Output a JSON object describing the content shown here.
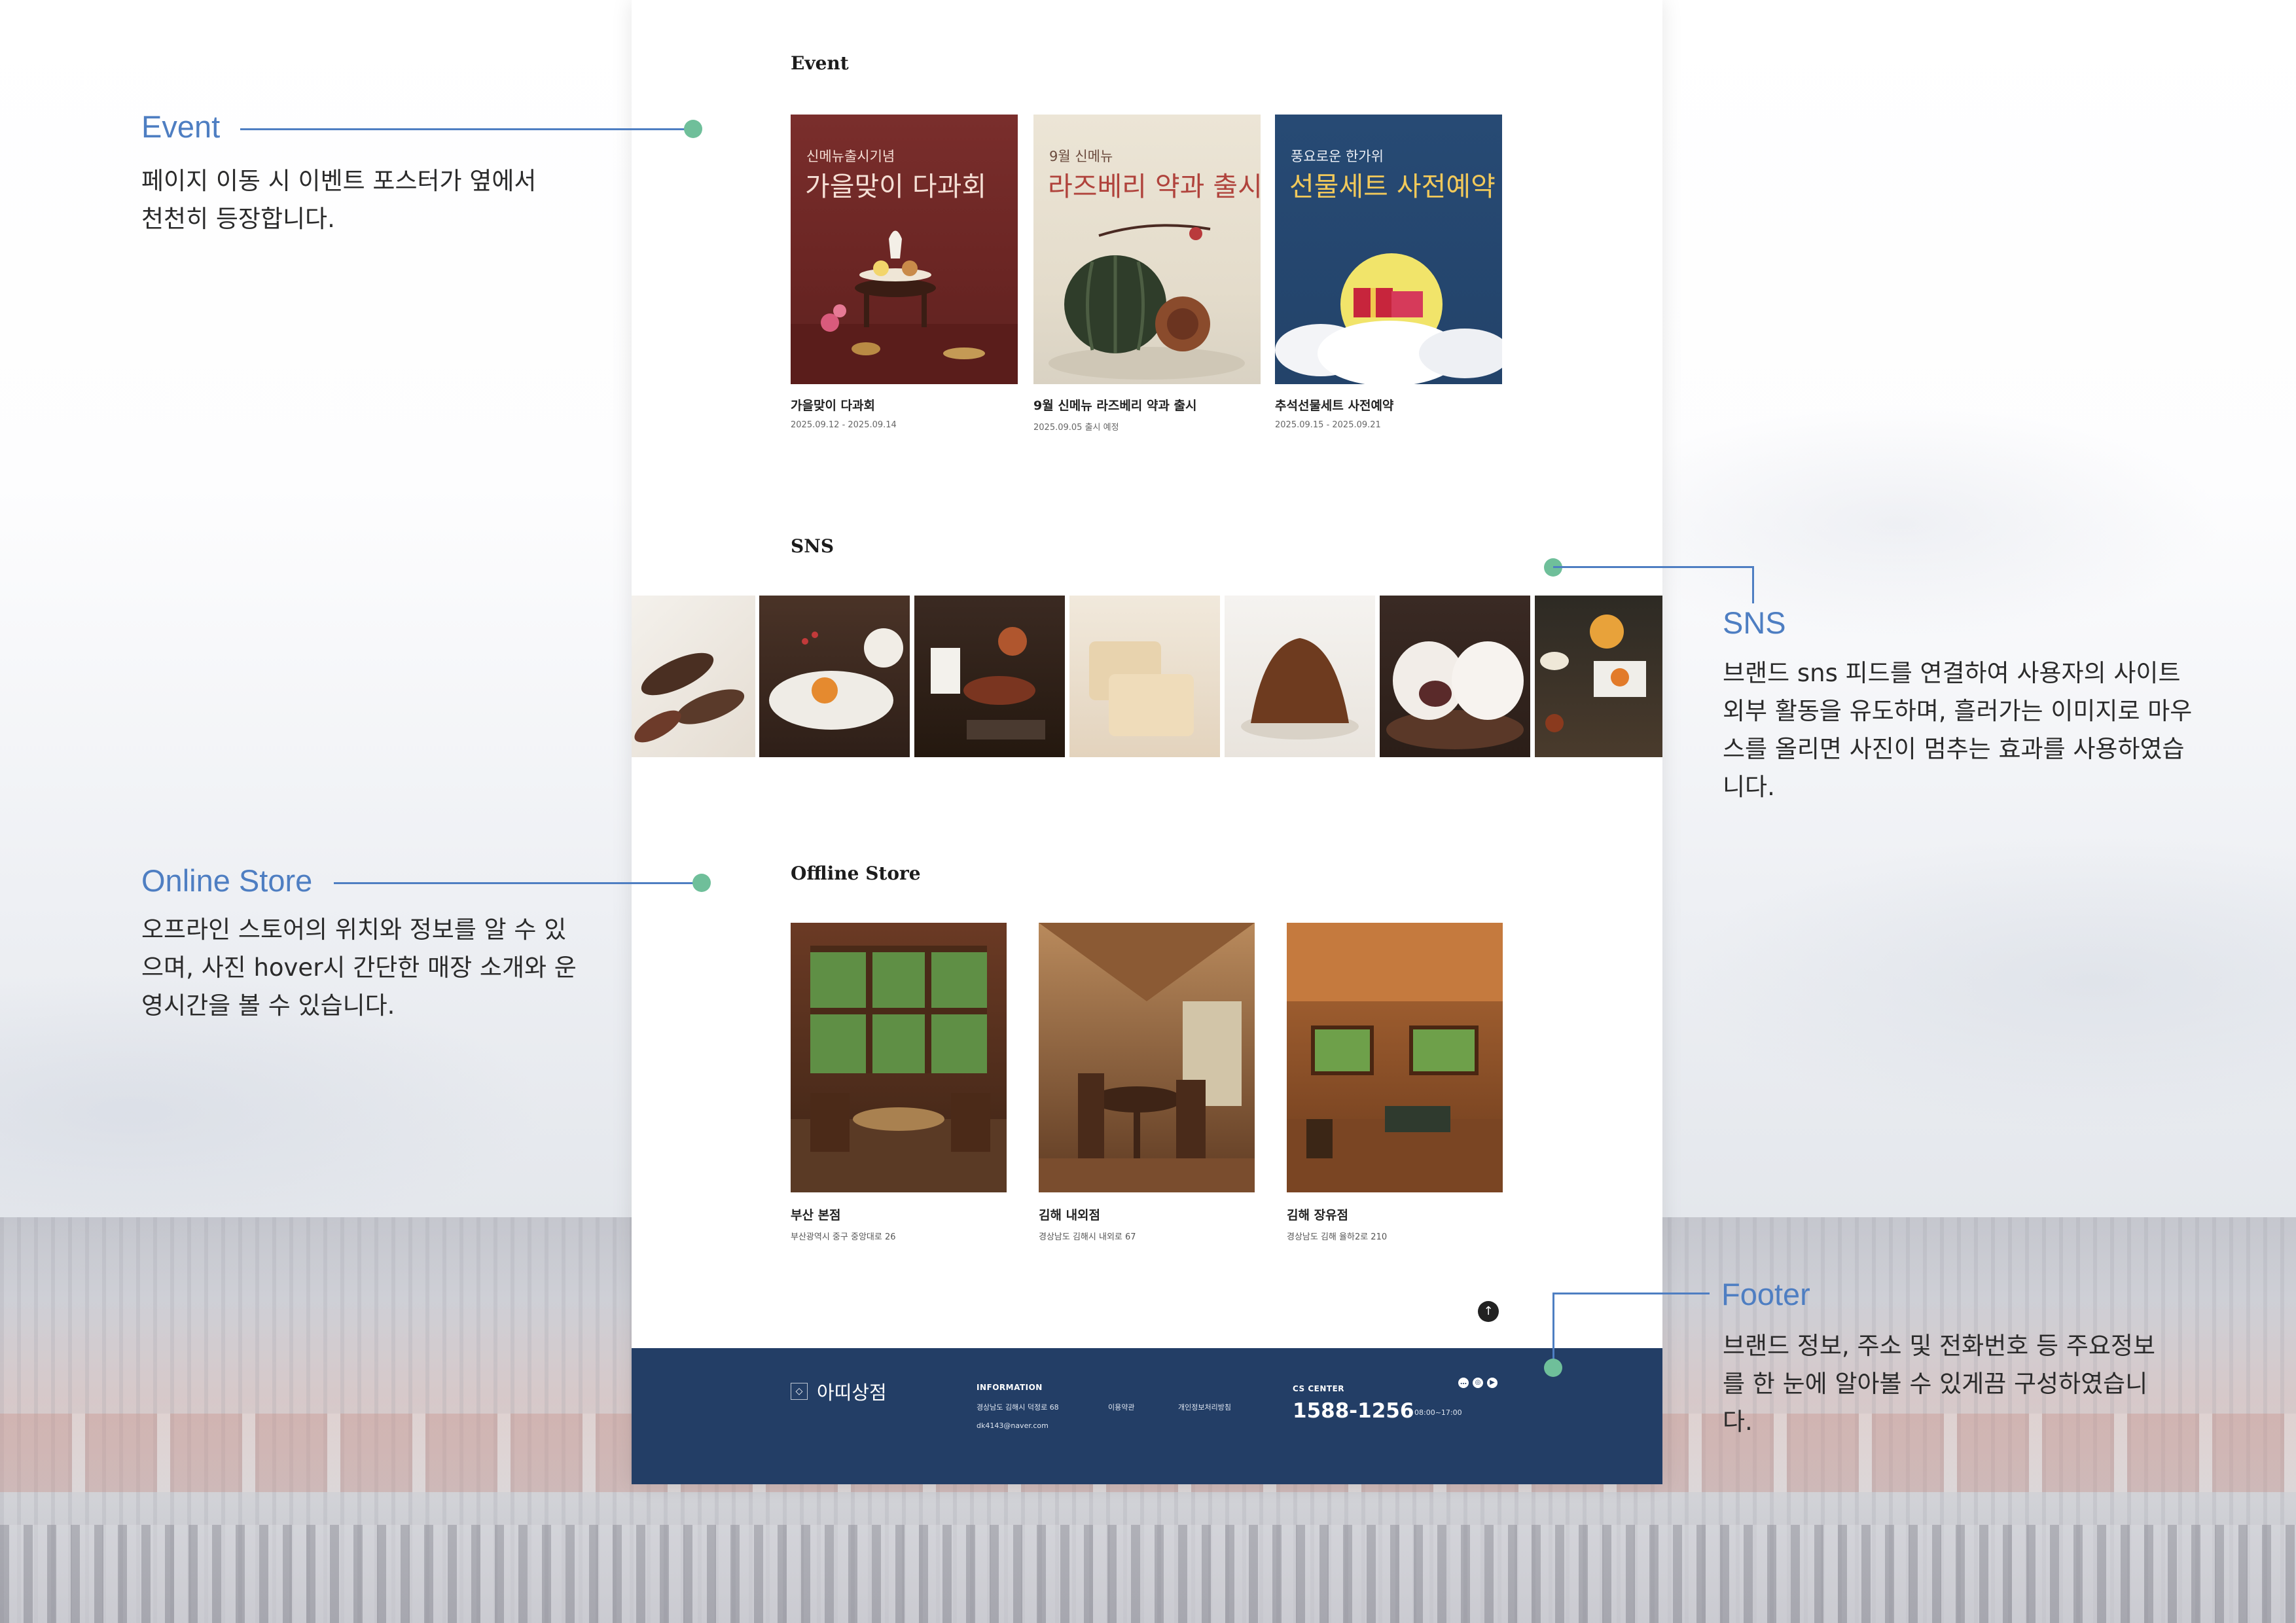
{
  "sections": {
    "event": "Event",
    "sns": "SNS",
    "store": "Offline Store"
  },
  "events": [
    {
      "poster_small": "신메뉴출시기념",
      "poster_big": "가을맞이 다과회",
      "name": "가을맞이 다과회",
      "date": "2025.09.12 - 2025.09.14"
    },
    {
      "poster_small": "9월 신메뉴",
      "poster_big": "라즈베리 약과 출시",
      "name": "9월 신메뉴 라즈베리 약과 출시",
      "date": "2025.09.05 출시 예정"
    },
    {
      "poster_small": "풍요로운 한가위",
      "poster_big": "선물세트 사전예약",
      "name": "추석선물세트 사전예약",
      "date": "2025.09.15 - 2025.09.21"
    }
  ],
  "stores": [
    {
      "name": "부산 본점",
      "address": "부산광역시 중구 중앙대로 26"
    },
    {
      "name": "김해 내외점",
      "address": "경상남도 김해시 내외로 67"
    },
    {
      "name": "김해 장유점",
      "address": "경상남도 김해 율하2로 210"
    }
  ],
  "footer": {
    "brand": "아띠상점",
    "info_heading": "INFORMATION",
    "address": "경상남도 김해시 덕정로 68",
    "email": "dk4143@naver.com",
    "terms": "이용약관",
    "privacy": "개인정보처리방침",
    "cs_heading": "CS CENTER",
    "phone": "1588-1256",
    "hours": "08:00~17:00",
    "social_icons": [
      "chat-icon",
      "instagram-icon",
      "youtube-icon"
    ]
  },
  "annotations": {
    "event": {
      "title": "Event",
      "lines": [
        "페이지 이동 시 이벤트 포스터가 옆에서",
        "천천히 등장합니다."
      ]
    },
    "sns": {
      "title": "SNS",
      "lines": [
        "브랜드 sns 피드를 연결하여 사용자의 사이트",
        "외부 활동을 유도하며, 흘러가는 이미지로 마우",
        "스를 올리면 사진이 멈추는 효과를 사용하였습",
        "니다."
      ]
    },
    "store": {
      "title": "Online Store",
      "lines": [
        "오프라인 스토어의 위치와 정보를 알 수 있",
        "으며, 사진 hover시 간단한 매장 소개와 운",
        "영시간을 볼 수 있습니다."
      ]
    },
    "footer": {
      "title": "Footer",
      "lines": [
        "브랜드 정보, 주소 및 전화번호 등 주요정보",
        "를 한 눈에 알아볼 수 있게끔 구성하였습니",
        "다."
      ]
    }
  },
  "colors": {
    "accent": "#4e7ec2",
    "connector_dot": "#6fbf9a",
    "footer_bg": "#233e66"
  }
}
